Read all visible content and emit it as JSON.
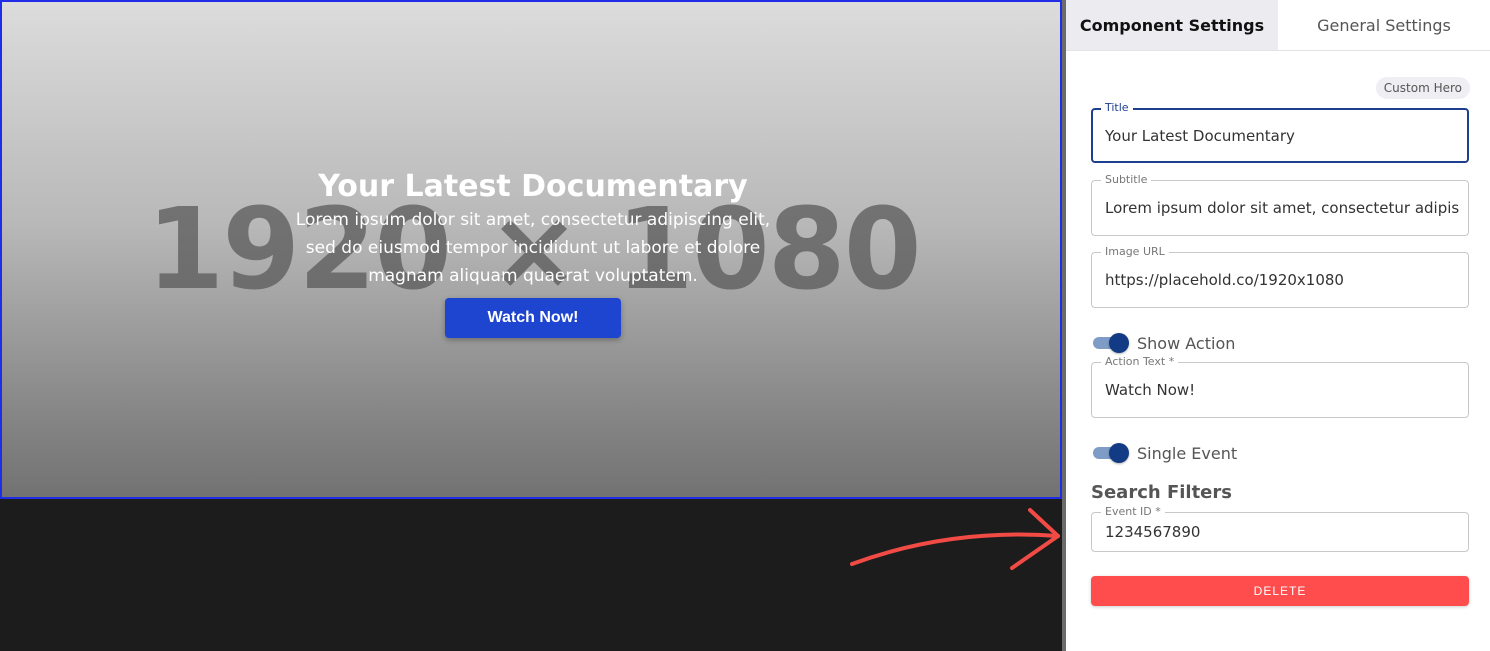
{
  "hero": {
    "placeholder_text": "1920 × 1080",
    "title": "Your Latest Documentary",
    "subtitle": "Lorem ipsum dolor sit amet, consectetur adipiscing elit, sed do eiusmod tempor incididunt ut labore et dolore magnam aliquam quaerat voluptatem.",
    "action_label": "Watch Now!"
  },
  "panel": {
    "tabs": [
      {
        "label": "Component Settings",
        "active": true
      },
      {
        "label": "General Settings",
        "active": false
      }
    ],
    "component_chip": "Custom Hero",
    "fields": {
      "title": {
        "label": "Title",
        "value": "Your Latest Documentary"
      },
      "subtitle": {
        "label": "Subtitle",
        "value": "Lorem ipsum dolor sit amet, consectetur adipiscing elit, sed do eiusmod tempor"
      },
      "image_url": {
        "label": "Image URL",
        "value": "https://placehold.co/1920x1080"
      },
      "action_text": {
        "label": "Action Text *",
        "value": "Watch Now!"
      },
      "event_id": {
        "label": "Event ID *",
        "value": "1234567890"
      }
    },
    "toggles": {
      "show_action": {
        "label": "Show Action",
        "on": true
      },
      "single_event": {
        "label": "Single Event",
        "on": true
      }
    },
    "search_filters_heading": "Search Filters",
    "delete_label": "DELETE"
  },
  "colors": {
    "accent": "#1e45cf",
    "selection_border": "#1f2ee6",
    "toggle_on": "#123a85",
    "danger": "#ff4d4d",
    "annotation_arrow": "#f24b45"
  }
}
